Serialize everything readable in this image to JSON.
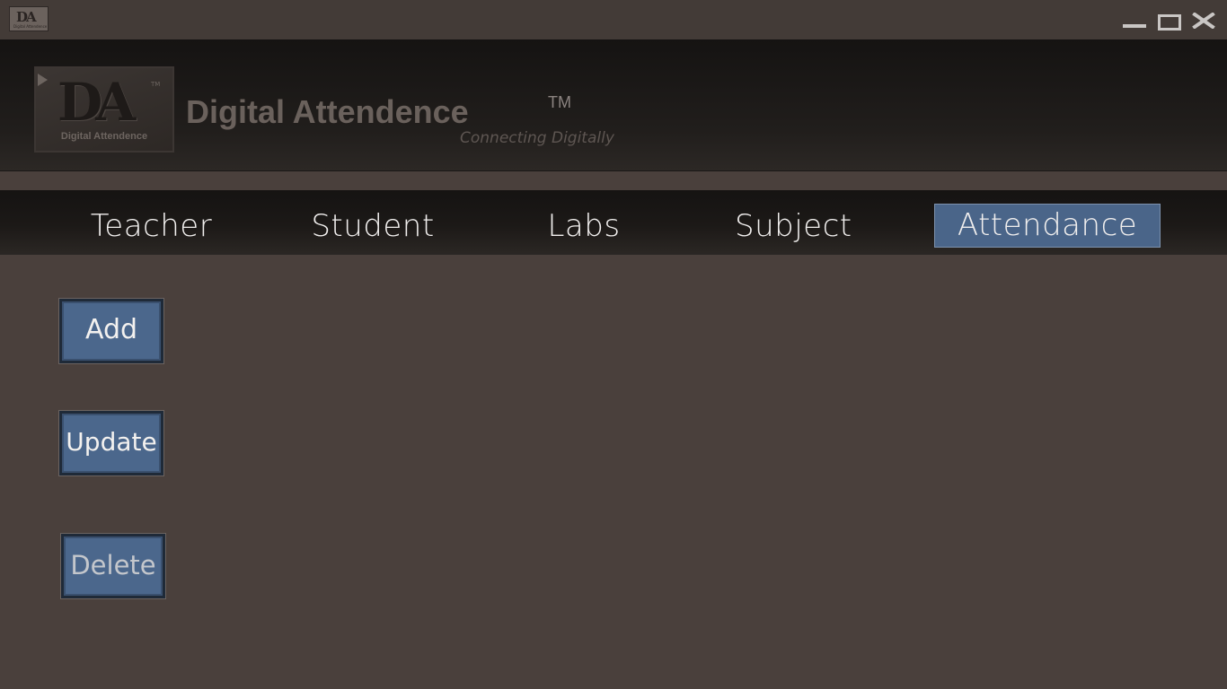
{
  "titlebar": {
    "icon_text": "DA",
    "icon_subtext": "Digital Attendence",
    "controls": [
      "minimize-icon",
      "maximize-icon",
      "close-icon"
    ]
  },
  "header": {
    "logo_letters": "DA",
    "logo_tm": "TM",
    "logo_caption": "Digital Attendence",
    "title": "Digital Attendence",
    "trademark": "TM",
    "tagline": "Connecting Digitally"
  },
  "nav": {
    "items": [
      {
        "label": "Teacher"
      },
      {
        "label": "Student"
      },
      {
        "label": "Labs"
      },
      {
        "label": "Subject"
      },
      {
        "label": "Attendance",
        "active": true
      }
    ]
  },
  "actions": {
    "add_label": "Add",
    "update_label": "Update",
    "delete_label": "Delete"
  },
  "colors": {
    "background": "#4a403c",
    "header": "#1c1917",
    "accent": "#4a6589",
    "text_light": "#f1efee"
  }
}
